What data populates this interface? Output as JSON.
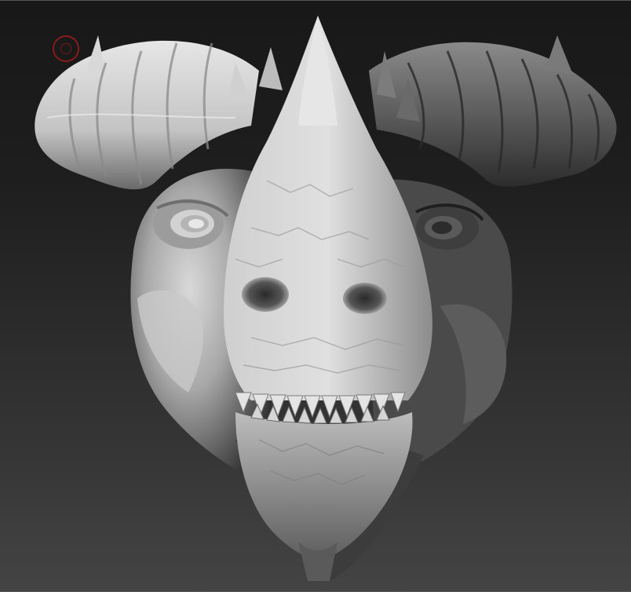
{
  "viewport": {
    "background_top": "#181818",
    "background_bottom": "#444444",
    "material_light": "#e4e4e4",
    "material_mid": "#9a9a9a",
    "material_dark": "#3a3a3a"
  },
  "brush_cursor": {
    "icon": "circle-brush-icon",
    "color": "#8a1b1b"
  },
  "model": {
    "icon": "dragon-head-sculpt"
  }
}
